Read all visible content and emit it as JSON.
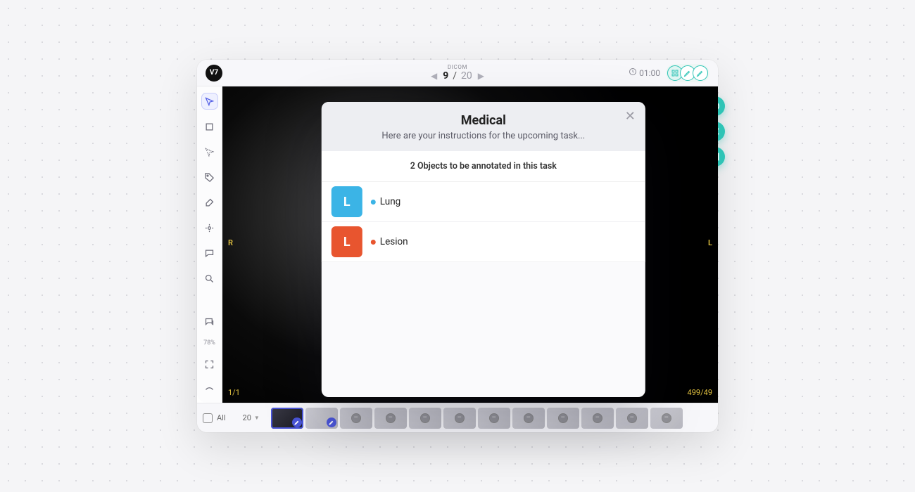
{
  "logo": "V7",
  "header": {
    "format_label": "DICOM",
    "current": "9",
    "separator": "/",
    "total": "20",
    "timer": "01:00"
  },
  "overlays": {
    "left_marker": "R",
    "right_marker": "L",
    "bottom_left": "1/1",
    "bottom_right": "499/49"
  },
  "sidebar": {
    "zoom": "78%"
  },
  "modal": {
    "title": "Medical",
    "subtitle": "Here are your instructions for the upcoming task...",
    "objects_heading": "2 Objects to be annotated in this task",
    "objects": [
      {
        "initial": "L",
        "name": "Lung",
        "color": "#3bb4e6",
        "chip_bg": "#3bb4e6"
      },
      {
        "initial": "L",
        "name": "Lesion",
        "color": "#e8552f",
        "chip_bg": "#e8552f"
      }
    ]
  },
  "filmstrip": {
    "all_label": "All",
    "count": "20"
  }
}
